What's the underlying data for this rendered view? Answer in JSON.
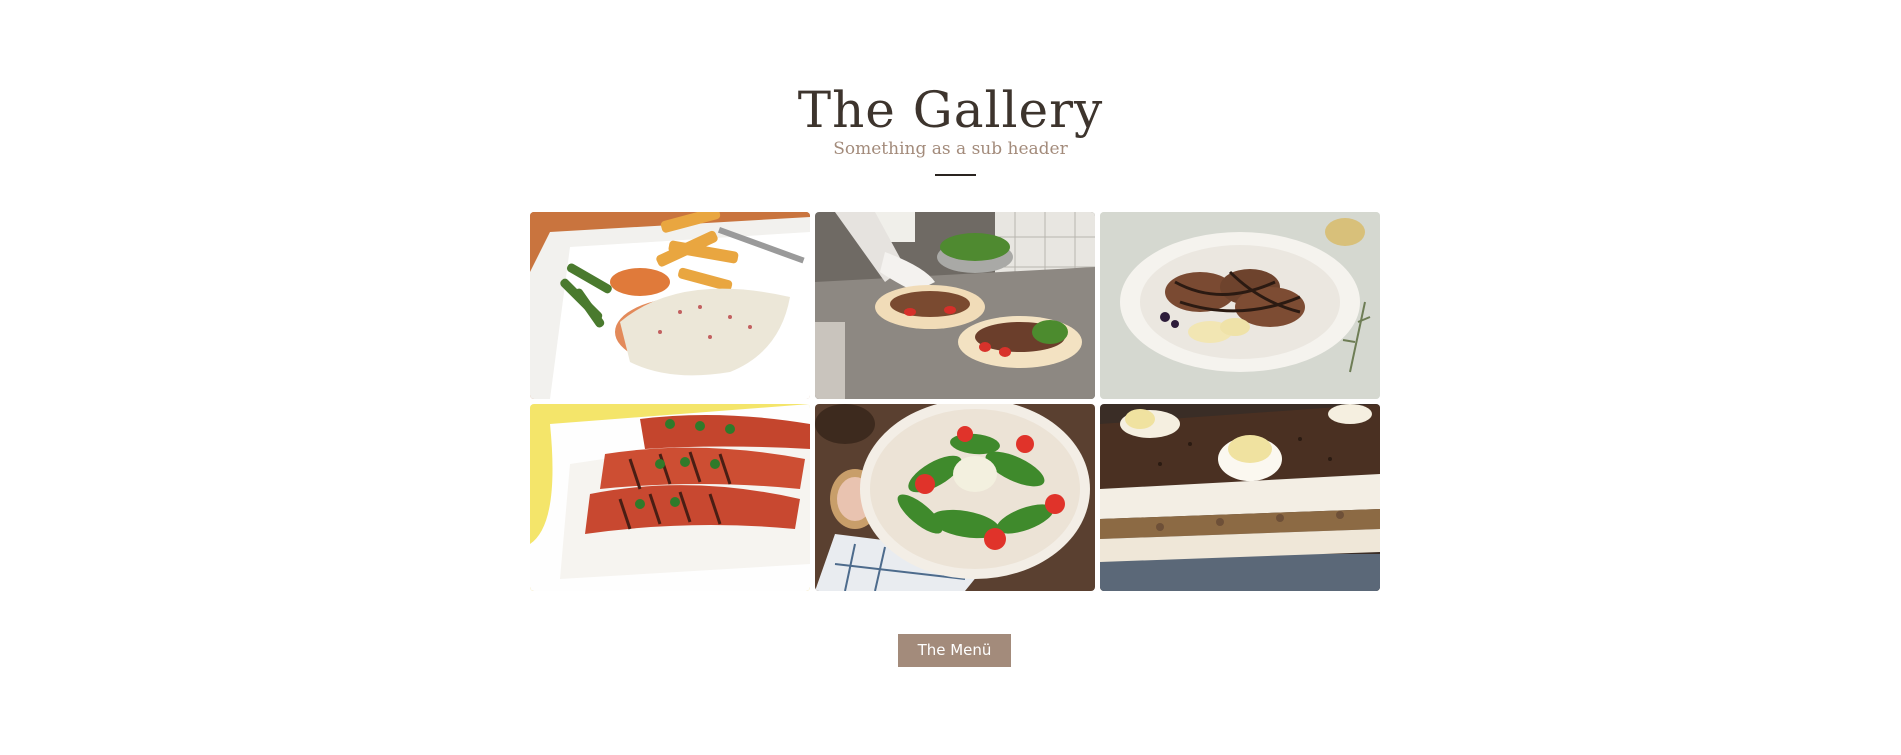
{
  "section": {
    "title": "The Gallery",
    "subtitle": "Something as a sub header"
  },
  "gallery": {
    "images": [
      {
        "subject": "salmon-fries-asparagus"
      },
      {
        "subject": "chef-preparing-wraps"
      },
      {
        "subject": "chocolate-pancakes"
      },
      {
        "subject": "grilled-chicken"
      },
      {
        "subject": "arugula-tomato-salad"
      },
      {
        "subject": "tiramisu-cake"
      }
    ]
  },
  "menu_button": {
    "label": "The Menü"
  },
  "colors": {
    "title": "#3d342d",
    "subtitle": "#a38b7b",
    "button_bg": "#a38b7b",
    "button_text": "#ffffff",
    "divider": "#2a2420"
  }
}
